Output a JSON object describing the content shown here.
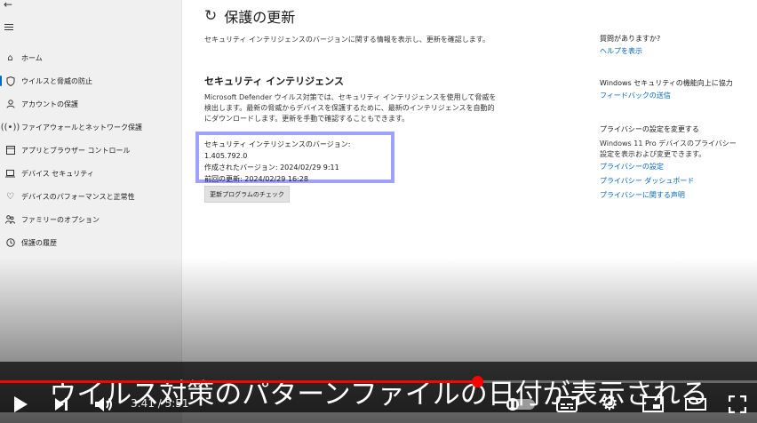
{
  "sidebar": {
    "back_icon": "arrow-left-icon",
    "menu_icon": "hamburger-icon",
    "items": [
      {
        "label": "ホーム",
        "icon": "home-icon"
      },
      {
        "label": "ウイルスと脅威の防止",
        "icon": "shield-icon"
      },
      {
        "label": "アカウントの保護",
        "icon": "person-icon"
      },
      {
        "label": "ファイアウォールとネットワーク保護",
        "icon": "wifi-icon"
      },
      {
        "label": "アプリとブラウザー コントロール",
        "icon": "window-icon"
      },
      {
        "label": "デバイス セキュリティ",
        "icon": "laptop-icon"
      },
      {
        "label": "デバイスのパフォーマンスと正常性",
        "icon": "heart-icon"
      },
      {
        "label": "ファミリーのオプション",
        "icon": "family-icon"
      },
      {
        "label": "保護の履歴",
        "icon": "history-icon"
      }
    ]
  },
  "main": {
    "title": "保護の更新",
    "subtitle": "セキュリティ インテリジェンスのバージョンに関する情報を表示し、更新を確認します。",
    "section_title": "セキュリティ インテリジェンス",
    "description": "Microsoft Defender ウイルス対策では、セキュリティ インテリジェンスを使用して脅威を検出します。最新の脅威からデバイスを保護するために、最新のインテリジェンスを自動的にダウンロードします。更新を手動で確認することもできます。",
    "version_line": "セキュリティ インテリジェンスのバージョン: 1.405.792.0",
    "created_line": "作成されたバージョン: 2024/02/29 9:11",
    "last_update_line": "前回の更新: 2024/02/29 16:28",
    "check_button": "更新プログラムのチェック",
    "highlight_color": "#9ea1ff"
  },
  "side_panel": {
    "question_head": "質問がありますか?",
    "help_link": "ヘルプを表示",
    "improve_head": "Windows セキュリティの機能向上に協力",
    "feedback_link": "フィードバックの送信",
    "privacy_head": "プライバシーの設定を変更する",
    "privacy_text": "Windows 11 Pro デバイスのプライバシー設定を表示および変更できます。",
    "privacy_links": [
      "プライバシーの設定",
      "プライバシー ダッシュボード",
      "プライバシーに関する声明"
    ]
  },
  "video": {
    "caption": "ウイルス対策のパターンファイルの日付が表示される",
    "time_current": "3:41",
    "time_total": "5:51",
    "time_display": "3:41 / 5:51",
    "progress": 0.63,
    "accent": "#ff0000",
    "icons": [
      "play-icon",
      "next-icon",
      "volume-icon",
      "autoplay-toggle",
      "subtitles-icon",
      "settings-icon",
      "miniplayer-icon",
      "theater-icon",
      "fullscreen-icon"
    ]
  }
}
